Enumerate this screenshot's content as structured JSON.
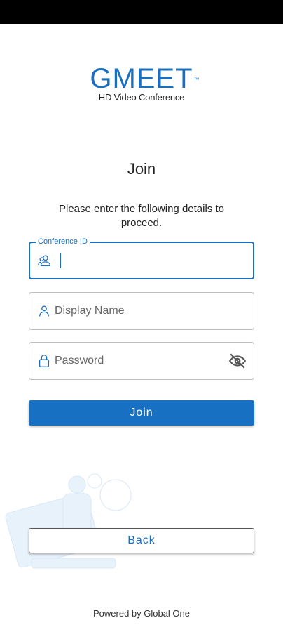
{
  "logo": {
    "title": "GMEET",
    "trademark": "™",
    "subtitle": "HD Video Conference"
  },
  "page": {
    "title": "Join",
    "instructions": "Please enter the following details to proceed."
  },
  "form": {
    "conference_id": {
      "label": "Conference ID",
      "value": "",
      "icon": "users-icon"
    },
    "display_name": {
      "placeholder": "Display Name",
      "value": "",
      "icon": "user-icon"
    },
    "password": {
      "placeholder": "Password",
      "value": "",
      "icon": "lock-icon",
      "toggle_icon": "eye-off-icon"
    }
  },
  "buttons": {
    "join": "Join",
    "back": "Back"
  },
  "footer": {
    "text": "Powered by Global One"
  },
  "colors": {
    "accent": "#1770c2",
    "border": "#bdbdbd",
    "status_bar": "#000000"
  }
}
